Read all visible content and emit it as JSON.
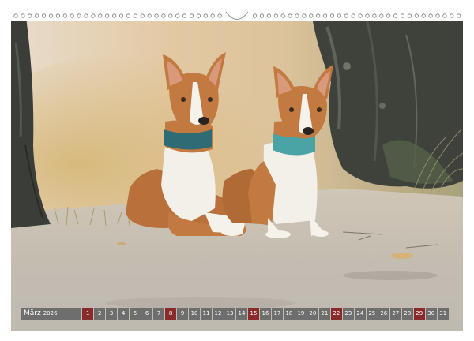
{
  "calendar": {
    "month": "März",
    "year": "2026",
    "days": [
      {
        "n": "1",
        "sunday": true
      },
      {
        "n": "2",
        "sunday": false
      },
      {
        "n": "3",
        "sunday": false
      },
      {
        "n": "4",
        "sunday": false
      },
      {
        "n": "5",
        "sunday": false
      },
      {
        "n": "6",
        "sunday": false
      },
      {
        "n": "7",
        "sunday": false
      },
      {
        "n": "8",
        "sunday": true
      },
      {
        "n": "9",
        "sunday": false
      },
      {
        "n": "10",
        "sunday": false
      },
      {
        "n": "11",
        "sunday": false
      },
      {
        "n": "12",
        "sunday": false
      },
      {
        "n": "13",
        "sunday": false
      },
      {
        "n": "14",
        "sunday": false
      },
      {
        "n": "15",
        "sunday": true
      },
      {
        "n": "16",
        "sunday": false
      },
      {
        "n": "17",
        "sunday": false
      },
      {
        "n": "18",
        "sunday": false
      },
      {
        "n": "19",
        "sunday": false
      },
      {
        "n": "20",
        "sunday": false
      },
      {
        "n": "21",
        "sunday": false
      },
      {
        "n": "22",
        "sunday": true
      },
      {
        "n": "23",
        "sunday": false
      },
      {
        "n": "24",
        "sunday": false
      },
      {
        "n": "25",
        "sunday": false
      },
      {
        "n": "26",
        "sunday": false
      },
      {
        "n": "27",
        "sunday": false
      },
      {
        "n": "28",
        "sunday": false
      },
      {
        "n": "29",
        "sunday": true
      },
      {
        "n": "30",
        "sunday": false
      },
      {
        "n": "31",
        "sunday": false
      }
    ]
  },
  "colors": {
    "day_cell": "#6e6e6e",
    "sunday_cell": "#8a2b2b",
    "collar_left": "#2f6b74",
    "collar_right": "#4aa3a5"
  },
  "photo": {
    "subject_icons": [
      "dog-left-icon",
      "dog-right-icon",
      "tree-trunk-icon"
    ]
  }
}
